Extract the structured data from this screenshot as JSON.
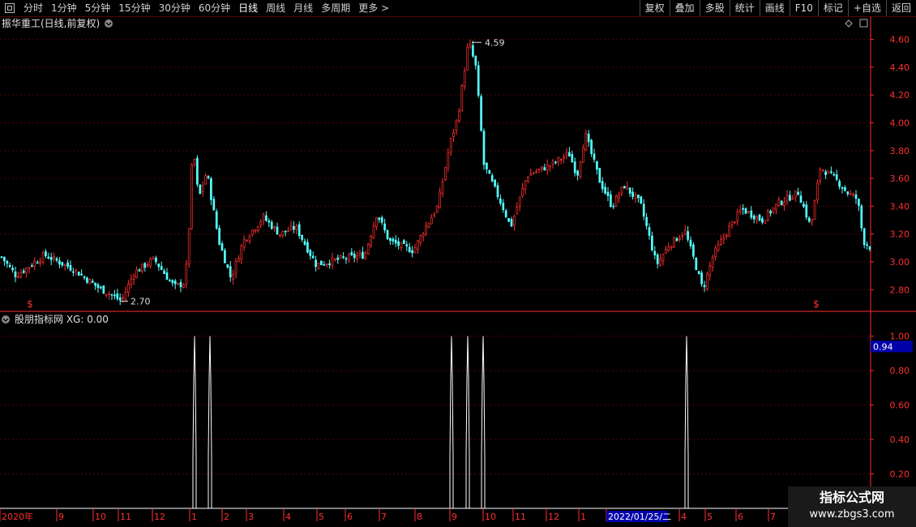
{
  "toolbar": {
    "periods": [
      "分时",
      "1分钟",
      "5分钟",
      "15分钟",
      "30分钟",
      "60分钟",
      "日线",
      "周线",
      "月线",
      "多周期",
      "更多 >"
    ],
    "active_period": "日线",
    "right_buttons": [
      "复权",
      "叠加",
      "多股",
      "统计",
      "画线",
      "F10",
      "+自选",
      "返回",
      "标记"
    ]
  },
  "main_panel": {
    "title": "振华重工(日线,前复权)",
    "high_label": "4.59",
    "low_label": "2.70",
    "signal_glyph": "$"
  },
  "indicator_panel": {
    "title": "股朋指标网 XG: 0.00",
    "current_value_badge": "0.94"
  },
  "x_axis": {
    "labels": [
      "2020年",
      "9",
      "10",
      "11",
      "12",
      "1",
      "2",
      "3",
      "4",
      "5",
      "6",
      "7",
      "8",
      "9",
      "10",
      "11",
      "12",
      "1",
      "2022/01/25/二",
      "4",
      "5",
      "6",
      "7"
    ]
  },
  "colors": {
    "up": "#ff3030",
    "down": "#54ffff",
    "grid": "#5a0000",
    "axis_text": "#ff3030",
    "badge_bg": "#0000aa"
  },
  "chart_data": [
    {
      "type": "candlestick",
      "title": "振华重工(日线,前复权)",
      "ylim": [
        2.65,
        4.65
      ],
      "y_ticks": [
        2.8,
        3.0,
        3.2,
        3.4,
        3.6,
        3.8,
        4.0,
        4.2,
        4.4,
        4.6
      ],
      "close_trend": [
        [
          0,
          3.05
        ],
        [
          20,
          2.9
        ],
        [
          55,
          3.05
        ],
        [
          90,
          2.95
        ],
        [
          120,
          2.82
        ],
        [
          150,
          2.72
        ],
        [
          165,
          2.92
        ],
        [
          190,
          3.02
        ],
        [
          215,
          2.82
        ],
        [
          228,
          2.85
        ],
        [
          232,
          3.1
        ],
        [
          238,
          3.85
        ],
        [
          245,
          3.45
        ],
        [
          255,
          3.65
        ],
        [
          270,
          3.15
        ],
        [
          285,
          2.88
        ],
        [
          300,
          3.15
        ],
        [
          325,
          3.32
        ],
        [
          345,
          3.2
        ],
        [
          365,
          3.25
        ],
        [
          390,
          2.98
        ],
        [
          420,
          3.02
        ],
        [
          450,
          3.05
        ],
        [
          465,
          3.35
        ],
        [
          480,
          3.15
        ],
        [
          510,
          3.08
        ],
        [
          525,
          3.25
        ],
        [
          540,
          3.4
        ],
        [
          555,
          3.85
        ],
        [
          565,
          4.05
        ],
        [
          578,
          4.59
        ],
        [
          587,
          4.4
        ],
        [
          597,
          3.7
        ],
        [
          620,
          3.4
        ],
        [
          630,
          3.25
        ],
        [
          650,
          3.62
        ],
        [
          680,
          3.7
        ],
        [
          702,
          3.78
        ],
        [
          712,
          3.62
        ],
        [
          722,
          3.92
        ],
        [
          740,
          3.58
        ],
        [
          755,
          3.4
        ],
        [
          770,
          3.55
        ],
        [
          790,
          3.42
        ],
        [
          800,
          3.2
        ],
        [
          810,
          2.98
        ],
        [
          825,
          3.12
        ],
        [
          845,
          3.22
        ],
        [
          857,
          3.0
        ],
        [
          867,
          2.8
        ],
        [
          880,
          3.05
        ],
        [
          900,
          3.25
        ],
        [
          915,
          3.38
        ],
        [
          940,
          3.3
        ],
        [
          960,
          3.42
        ],
        [
          985,
          3.5
        ],
        [
          1000,
          3.25
        ],
        [
          1012,
          3.68
        ],
        [
          1030,
          3.6
        ],
        [
          1045,
          3.5
        ],
        [
          1058,
          3.45
        ],
        [
          1065,
          3.15
        ],
        [
          1075,
          3.1
        ]
      ],
      "annotations": [
        {
          "label": "4.59",
          "value": 4.59
        },
        {
          "label": "2.70",
          "value": 2.7
        }
      ],
      "signals": [
        "$",
        "$"
      ]
    },
    {
      "type": "line",
      "title": "股朋指标网 XG: 0.00",
      "ylim": [
        0,
        1.05
      ],
      "y_ticks": [
        0.2,
        0.4,
        0.6,
        0.8,
        1.0
      ],
      "spike_value": 1.0,
      "spike_count": 6,
      "current_value": 0.94
    }
  ]
}
